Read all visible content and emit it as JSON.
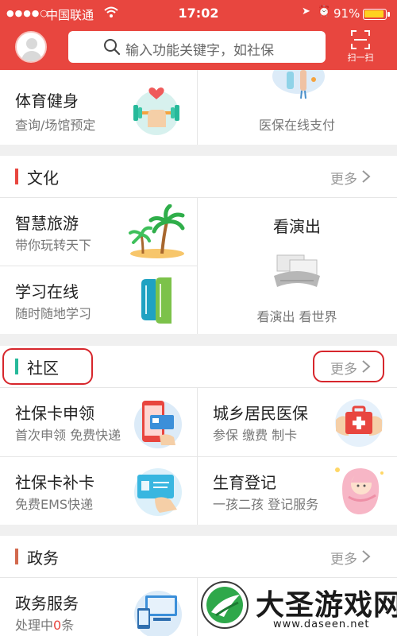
{
  "status_bar": {
    "carrier": "中国联通",
    "time": "17:02",
    "battery": "91%"
  },
  "header": {
    "search_placeholder": "输入功能关键字，如社保",
    "scan_label": "扫一扫"
  },
  "top_partial": {
    "left": {
      "title": "体育健身",
      "subtitle": "查询/场馆预定",
      "icon": "fitness-dumbbell-icon"
    },
    "right": {
      "subtitle": "医保在线支付",
      "icon": "medical-payment-illustration"
    }
  },
  "sections": [
    {
      "title": "文化",
      "more": "更多",
      "accent": "#e8463f",
      "items": [
        {
          "title": "智慧旅游",
          "subtitle": "带你玩转天下",
          "icon": "palm-island-icon"
        },
        {
          "title": "看演出",
          "subtitle": "看演出  看世界",
          "icon": "theater-tickets-illustration"
        },
        {
          "title": "学习在线",
          "subtitle": "随时随地学习",
          "icon": "books-icon"
        }
      ]
    },
    {
      "title": "社区",
      "more": "更多",
      "accent": "#26b99a",
      "items": [
        {
          "title": "社保卡申领",
          "subtitle": "首次申领 免费快递",
          "icon": "phone-card-icon"
        },
        {
          "title": "城乡居民医保",
          "subtitle": "参保 缴费 制卡",
          "icon": "medical-kit-icon"
        },
        {
          "title": "社保卡补卡",
          "subtitle": "免费EMS快递",
          "icon": "hand-card-icon"
        },
        {
          "title": "生育登记",
          "subtitle": "一孩二孩 登记服务",
          "icon": "baby-icon"
        }
      ]
    },
    {
      "title": "政务",
      "more": "更多",
      "accent": "#e8463f",
      "items": [
        {
          "title": "政务服务",
          "subtitle_prefix": "处理中",
          "subtitle_count": "0",
          "subtitle_suffix": "条",
          "icon": "devices-icon"
        }
      ]
    }
  ],
  "watermark": {
    "name": "大圣游戏网",
    "url": "www.daseen.net"
  },
  "colors": {
    "header_red": "#e8463f",
    "annotation_red": "#d7262c",
    "community_green": "#26b99a"
  }
}
